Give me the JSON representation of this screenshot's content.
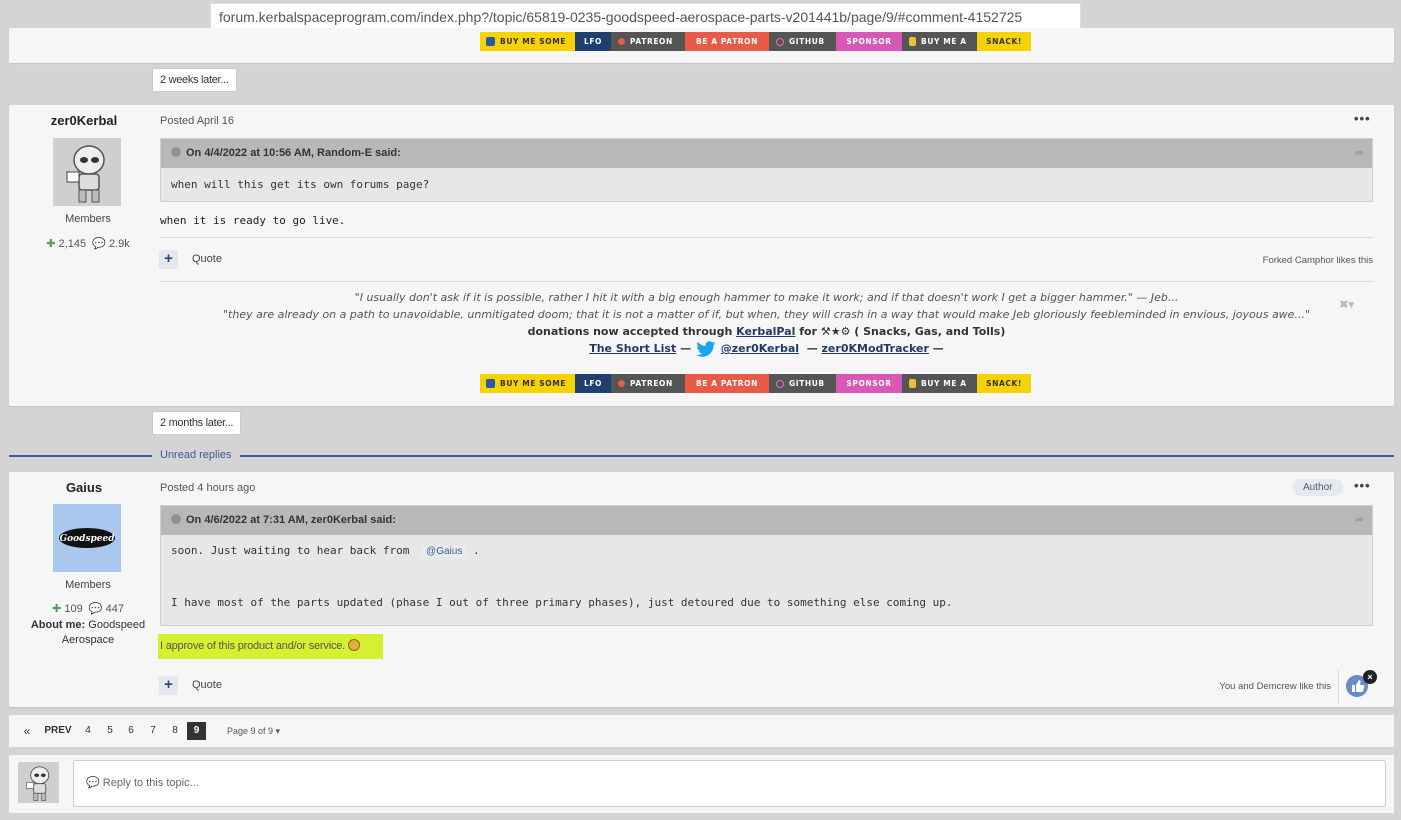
{
  "browser": {
    "url": "forum.kerbalspaceprogram.com/index.php?/topic/65819-0235-goodspeed-aerospace-parts-v201441b/page/9/#comment-4152725"
  },
  "badges": [
    {
      "cls": "b-paypal",
      "icon": "paypal-icon",
      "label": "Buy me some"
    },
    {
      "cls": "b-lfo",
      "icon": "",
      "label": "LFO"
    },
    {
      "cls": "b-patreon",
      "icon": "patreon-icon",
      "label": "Patreon"
    },
    {
      "cls": "b-bepatron",
      "icon": "",
      "label": "Be a Patron"
    },
    {
      "cls": "b-github",
      "icon": "heart-icon",
      "label": "GitHub"
    },
    {
      "cls": "b-sponsor",
      "icon": "",
      "label": "Sponsor"
    },
    {
      "cls": "b-buyme",
      "icon": "cup-icon",
      "label": "Buy me a"
    },
    {
      "cls": "b-snack",
      "icon": "",
      "label": "Snack!"
    }
  ],
  "timegaps": {
    "first": "2 weeks later...",
    "second": "2 months later..."
  },
  "post1": {
    "author": "zer0Kerbal",
    "group": "Members",
    "reputation": "2,145",
    "posts": "2.9k",
    "posted": "Posted April 16",
    "quote_header": "On 4/4/2022 at 10:56 AM, Random-E said:",
    "quote_body": "when will this get its own forums page?",
    "text": "when it is ready to go live.",
    "quote_label": "Quote",
    "likes": "Forked Camphor likes this",
    "sig": {
      "line1": "\"I usually don't ask if it is possible, rather I hit it with a big enough hammer to make it work; and if that doesn't work I get a bigger hammer.\"  — Jeb...",
      "line2": "\"they are already on a path to unavoidable, unmitigated doom; that it is not a matter of if, but when, they will crash in a way that would make Jeb gloriously feebleminded in envious, joyous awe...\"",
      "donations_pre": "donations now accepted through",
      "kerbalpal": "KerbalPal",
      "for": "for",
      "donation_items": "( Snacks, Gas, and Tolls)",
      "short_list": "The Short List",
      "twitter_handle": "@zer0Kerbal",
      "mod_tracker": "zer0KModTracker",
      "dash": "—"
    }
  },
  "unread_label": "Unread replies",
  "post2": {
    "author": "Gaius",
    "avatar_text": "Goodspeed",
    "group": "Members",
    "reputation": "109",
    "posts": "447",
    "about_label": "About me:",
    "about_value": "Goodspeed Aerospace",
    "posted": "Posted 4 hours ago",
    "author_badge": "Author",
    "quote_header": "On 4/6/2022 at 7:31 AM, zer0Kerbal said:",
    "quote_line1_pre": "soon. Just waiting to hear back from",
    "mention": "@Gaius",
    "quote_line1_post": ".",
    "quote_line2": "I have most of the parts updated (phase I out of three primary phases), just detoured due to something else coming up.",
    "approve_text": "I approve of this product and/or service.",
    "quote_label": "Quote",
    "likes": "You and Demcrew like this",
    "like_remove": "×"
  },
  "pagination": {
    "first": "«",
    "prev": "PREV",
    "pages": [
      "4",
      "5",
      "6",
      "7",
      "8"
    ],
    "current": "9",
    "info": "Page 9 of 9 ▾"
  },
  "reply": {
    "placeholder": "Reply to this topic..."
  },
  "colors": {
    "accent": "#3b5c92",
    "highlight": "#d6ef2e"
  }
}
